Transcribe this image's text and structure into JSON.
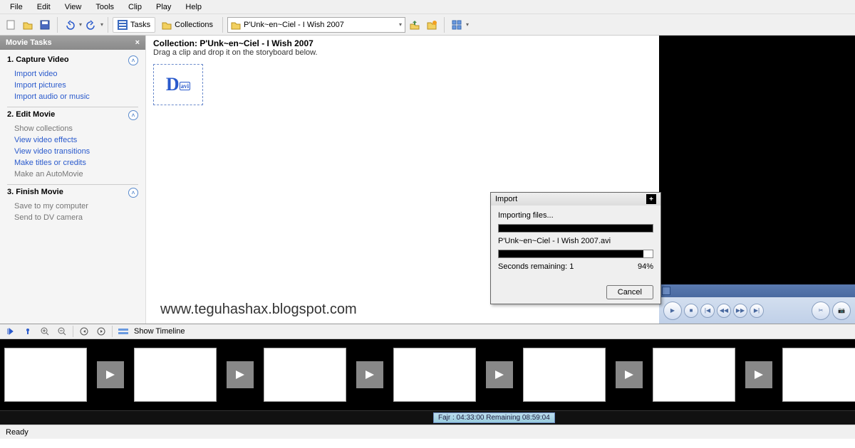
{
  "menu": {
    "file": "File",
    "edit": "Edit",
    "view": "View",
    "tools": "Tools",
    "clip": "Clip",
    "play": "Play",
    "help": "Help"
  },
  "toolbar": {
    "tasks": "Tasks",
    "collections": "Collections",
    "dropdown": "P'Unk~en~Ciel - I Wish 2007"
  },
  "sidebar": {
    "header": "Movie Tasks",
    "sec1": {
      "title": "1. Capture Video",
      "items": [
        "Import video",
        "Import pictures",
        "Import audio or music"
      ]
    },
    "sec2": {
      "title": "2. Edit Movie",
      "items": [
        "Show collections",
        "View video effects",
        "View video transitions",
        "Make titles or credits",
        "Make an AutoMovie"
      ]
    },
    "sec3": {
      "title": "3. Finish Movie",
      "items": [
        "Save to my computer",
        "Send to DV camera"
      ]
    }
  },
  "content": {
    "title": "Collection: P'Unk~en~Ciel - I Wish 2007",
    "subtitle": "Drag a clip and drop it on the storyboard below.",
    "watermark": "www.teguhashax.blogspot.com"
  },
  "dialog": {
    "title": "Import",
    "line1": "Importing files...",
    "filename": "P'Unk~en~Ciel - I Wish 2007.avi",
    "remaining_label": "Seconds remaining:",
    "remaining_value": "1",
    "percent": "94%",
    "cancel": "Cancel"
  },
  "timeline": {
    "show": "Show Timeline"
  },
  "prayer": "Fajr : 04:33:00  Remaining 08:59:04",
  "status": "Ready"
}
